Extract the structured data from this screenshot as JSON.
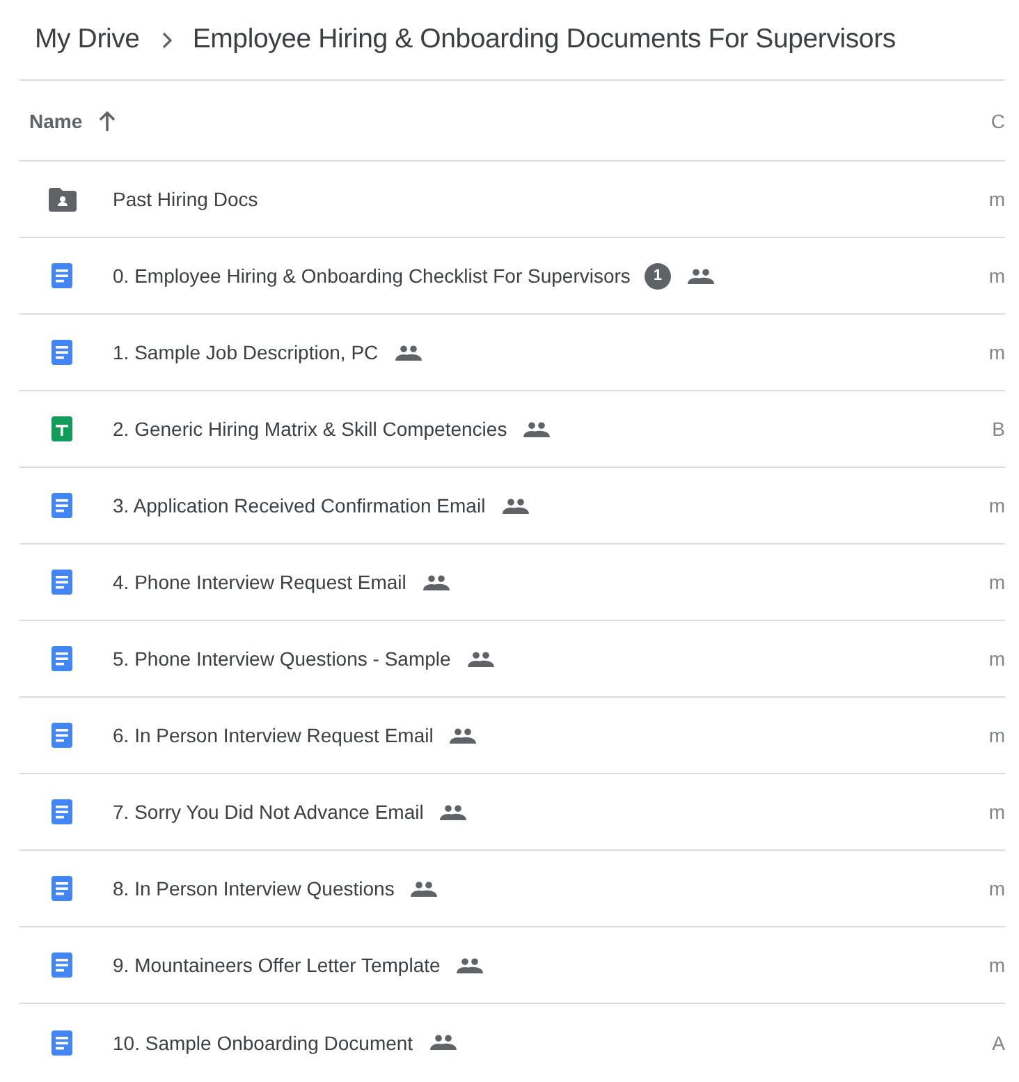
{
  "breadcrumb": [
    {
      "label": "My Drive"
    },
    {
      "label": "Employee Hiring & Onboarding Documents For Supervisors"
    }
  ],
  "table": {
    "columns": [
      {
        "label": "Name",
        "sort_ascending": true
      },
      {
        "label": "C"
      }
    ],
    "rows": [
      {
        "kind": "folder",
        "name": "Past Hiring Docs",
        "shared": false,
        "column_2": "m"
      },
      {
        "kind": "doc",
        "name": "0. Employee Hiring & Onboarding Checklist For Supervisors",
        "badge": "1",
        "shared": true,
        "column_2": "m"
      },
      {
        "kind": "doc",
        "name": "1. Sample Job Description, PC",
        "shared": true,
        "column_2": "m"
      },
      {
        "kind": "sheet",
        "name": "2. Generic Hiring Matrix & Skill Competencies",
        "shared": true,
        "column_2": "B"
      },
      {
        "kind": "doc",
        "name": "3. Application Received Confirmation Email",
        "shared": true,
        "column_2": "m"
      },
      {
        "kind": "doc",
        "name": "4. Phone Interview Request Email",
        "shared": true,
        "column_2": "m"
      },
      {
        "kind": "doc",
        "name": "5. Phone Interview Questions - Sample",
        "shared": true,
        "column_2": "m"
      },
      {
        "kind": "doc",
        "name": "6. In Person Interview Request Email",
        "shared": true,
        "column_2": "m"
      },
      {
        "kind": "doc",
        "name": "7. Sorry You Did Not Advance Email",
        "shared": true,
        "column_2": "m"
      },
      {
        "kind": "doc",
        "name": "8. In Person Interview Questions",
        "shared": true,
        "column_2": "m"
      },
      {
        "kind": "doc",
        "name": "9. Mountaineers Offer Letter Template",
        "shared": true,
        "column_2": "m"
      },
      {
        "kind": "doc",
        "name": "10. Sample Onboarding Document",
        "shared": true,
        "column_2": "A"
      }
    ]
  }
}
